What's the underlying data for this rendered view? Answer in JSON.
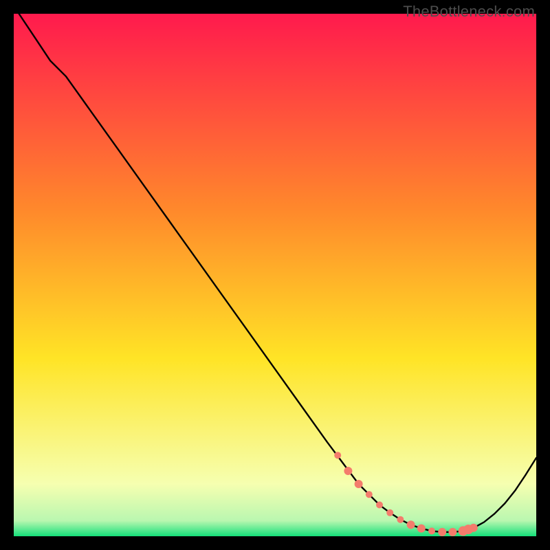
{
  "attribution": "TheBottleneck.com",
  "colors": {
    "frame": "#000000",
    "gradient_top": "#ff1a4d",
    "gradient_mid1": "#ff8a2b",
    "gradient_mid2": "#ffe426",
    "gradient_low": "#f6ffb0",
    "gradient_green": "#14e07a",
    "curve": "#000000",
    "marker": "#f47c6c"
  },
  "chart_data": {
    "type": "line",
    "title": "",
    "xlabel": "",
    "ylabel": "",
    "xlim": [
      0,
      100
    ],
    "ylim": [
      0,
      100
    ],
    "series": [
      {
        "name": "curve",
        "x": [
          1,
          5,
          7,
          10,
          15,
          20,
          25,
          30,
          35,
          40,
          45,
          50,
          55,
          60,
          63,
          66,
          68,
          70,
          72,
          74,
          76,
          78,
          80,
          82,
          84,
          86,
          88,
          90,
          92,
          94,
          96,
          98,
          100
        ],
        "y": [
          100,
          94,
          91,
          88,
          81,
          74,
          67,
          60,
          53,
          46,
          39,
          32,
          25,
          18,
          14,
          10,
          8,
          6,
          4.5,
          3.2,
          2.2,
          1.5,
          1.0,
          0.8,
          0.8,
          1.0,
          1.6,
          2.7,
          4.3,
          6.3,
          8.8,
          11.8,
          15
        ]
      }
    ],
    "markers": {
      "name": "highlight-points",
      "x": [
        62,
        64,
        66,
        68,
        70,
        72,
        74,
        76,
        78,
        80,
        82,
        84,
        86,
        87,
        88
      ],
      "y": [
        15.5,
        12.5,
        10.0,
        8.0,
        6.0,
        4.5,
        3.2,
        2.2,
        1.5,
        1.0,
        0.8,
        0.8,
        1.0,
        1.3,
        1.6
      ],
      "r": [
        5,
        6,
        6,
        5,
        5,
        5,
        5,
        6,
        6,
        5,
        6,
        6,
        7,
        7,
        6
      ]
    }
  }
}
